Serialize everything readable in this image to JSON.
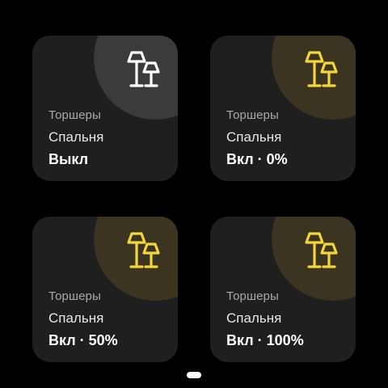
{
  "tiles": [
    {
      "category": "Торшеры",
      "room": "Спальня",
      "state": "Выкл",
      "on": false,
      "level_percent": 0,
      "icon": "floor-lamp-icon",
      "icon_color": "#ffffff"
    },
    {
      "category": "Торшеры",
      "room": "Спальня",
      "state": "Вкл · 0%",
      "on": true,
      "level_percent": 0,
      "icon": "floor-lamp-icon",
      "icon_color": "#f5d63a"
    },
    {
      "category": "Торшеры",
      "room": "Спальня",
      "state": "Вкл · 50%",
      "on": true,
      "level_percent": 50,
      "icon": "floor-lamp-icon",
      "icon_color": "#f5d63a"
    },
    {
      "category": "Торшеры",
      "room": "Спальня",
      "state": "Вкл · 100%",
      "on": true,
      "level_percent": 100,
      "icon": "floor-lamp-icon",
      "icon_color": "#f5d63a"
    }
  ],
  "colors": {
    "background": "#000000",
    "tile_background": "#1f1f1f",
    "accent_on": "#f5d63a",
    "icon_off": "#ffffff"
  },
  "pager": {
    "current_page": 1
  }
}
